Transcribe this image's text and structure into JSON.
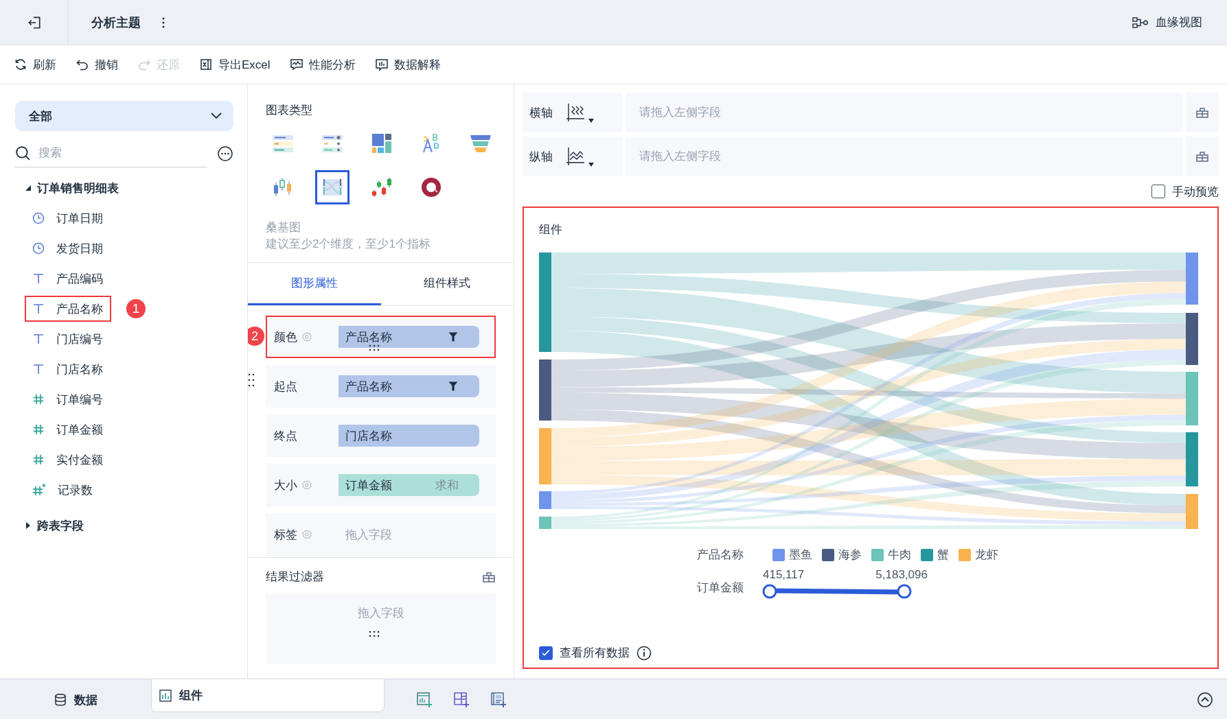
{
  "topbar": {
    "title": "分析主题",
    "lineage_button": "血缘视图"
  },
  "toolbar": [
    {
      "kind": "refresh",
      "label": "刷新",
      "disabled": false
    },
    {
      "kind": "undo",
      "label": "撤销",
      "disabled": false
    },
    {
      "kind": "redo",
      "label": "还原",
      "disabled": true
    },
    {
      "kind": "excel",
      "label": "导出Excel",
      "disabled": false
    },
    {
      "kind": "performance",
      "label": "性能分析",
      "disabled": false
    },
    {
      "kind": "explain",
      "label": "数据解释",
      "disabled": false
    }
  ],
  "data_panel": {
    "scope": "全部",
    "search": {
      "placeholder": "搜索"
    },
    "tree": [
      {
        "label": "订单销售明细表",
        "expanded": true,
        "children": [
          {
            "kind": "date",
            "label": "订单日期",
            "highlighted": false
          },
          {
            "kind": "date",
            "label": "发货日期",
            "highlighted": false
          },
          {
            "kind": "text",
            "label": "产品编码",
            "highlighted": false
          },
          {
            "kind": "text",
            "label": "产品名称",
            "highlighted": true,
            "callout": "1"
          },
          {
            "kind": "text",
            "label": "门店编号",
            "highlighted": false
          },
          {
            "kind": "text",
            "label": "门店名称",
            "highlighted": false
          },
          {
            "kind": "number",
            "label": "订单编号",
            "highlighted": false
          },
          {
            "kind": "number",
            "label": "订单金额",
            "highlighted": false
          },
          {
            "kind": "number",
            "label": "实付金额",
            "highlighted": false
          },
          {
            "kind": "count",
            "label": "记录数",
            "highlighted": false
          }
        ]
      },
      {
        "label": "跨表字段",
        "expanded": false
      }
    ]
  },
  "chart_panel": {
    "title": "图表类型",
    "chart_types": [
      {
        "kind": "ranked-list",
        "selected": false
      },
      {
        "kind": "dot-list",
        "selected": false
      },
      {
        "kind": "treemap",
        "selected": false
      },
      {
        "kind": "word-cloud",
        "selected": false
      },
      {
        "kind": "funnel",
        "selected": false
      },
      {
        "kind": "box-plot",
        "selected": false
      },
      {
        "kind": "sankey",
        "selected": true
      },
      {
        "kind": "candlestick",
        "selected": false
      },
      {
        "kind": "ring",
        "selected": false
      }
    ],
    "chart_name": "桑基图",
    "hint": "建议至少2个维度，至少1个指标",
    "tabs": [
      {
        "label": "图形属性",
        "selected": true
      },
      {
        "label": "组件样式",
        "selected": false
      }
    ],
    "properties": [
      {
        "label": "颜色",
        "settings": true,
        "kind": "dimension",
        "field": "产品名称",
        "filter": true,
        "highlighted": true,
        "callout": "2"
      },
      {
        "label": "起点",
        "settings": false,
        "kind": "dimension",
        "field": "产品名称",
        "filter": true,
        "highlighted": false
      },
      {
        "label": "终点",
        "settings": false,
        "kind": "dimension",
        "field": "门店名称",
        "filter": false,
        "highlighted": false
      },
      {
        "label": "大小",
        "settings": true,
        "kind": "measure",
        "field": "订单金额",
        "aggregation": "求和",
        "filter": false,
        "highlighted": false
      },
      {
        "label": "标签",
        "settings": true,
        "kind": "empty",
        "placeholder": "拖入字段",
        "filter": false,
        "highlighted": false
      }
    ],
    "result_filter": {
      "title": "结果过滤器",
      "placeholder": "拖入字段"
    }
  },
  "axes": [
    {
      "kind": "x",
      "label": "横轴",
      "placeholder": "请拖入左侧字段"
    },
    {
      "kind": "y",
      "label": "纵轴",
      "placeholder": "请拖入左侧字段"
    }
  ],
  "manual_preview": {
    "label": "手动预览",
    "checked": false
  },
  "component": {
    "title": "组件",
    "highlighted": true,
    "legend": {
      "title": "产品名称",
      "items": [
        {
          "label": "墨鱼",
          "color": "#7094ec"
        },
        {
          "label": "海参",
          "color": "#4a5a80"
        },
        {
          "label": "牛肉",
          "color": "#6cc3b8"
        },
        {
          "label": "蟹",
          "color": "#27979e"
        },
        {
          "label": "龙虾",
          "color": "#f8b24e"
        }
      ]
    },
    "range": {
      "title": "订单金额",
      "min": "415,117",
      "max": "5,183,096"
    },
    "view_all": {
      "label": "查看所有数据",
      "checked": true
    }
  },
  "bottom_tabs": [
    {
      "kind": "data",
      "label": "数据",
      "selected": false
    },
    {
      "kind": "component",
      "label": "组件",
      "selected": true
    }
  ]
}
